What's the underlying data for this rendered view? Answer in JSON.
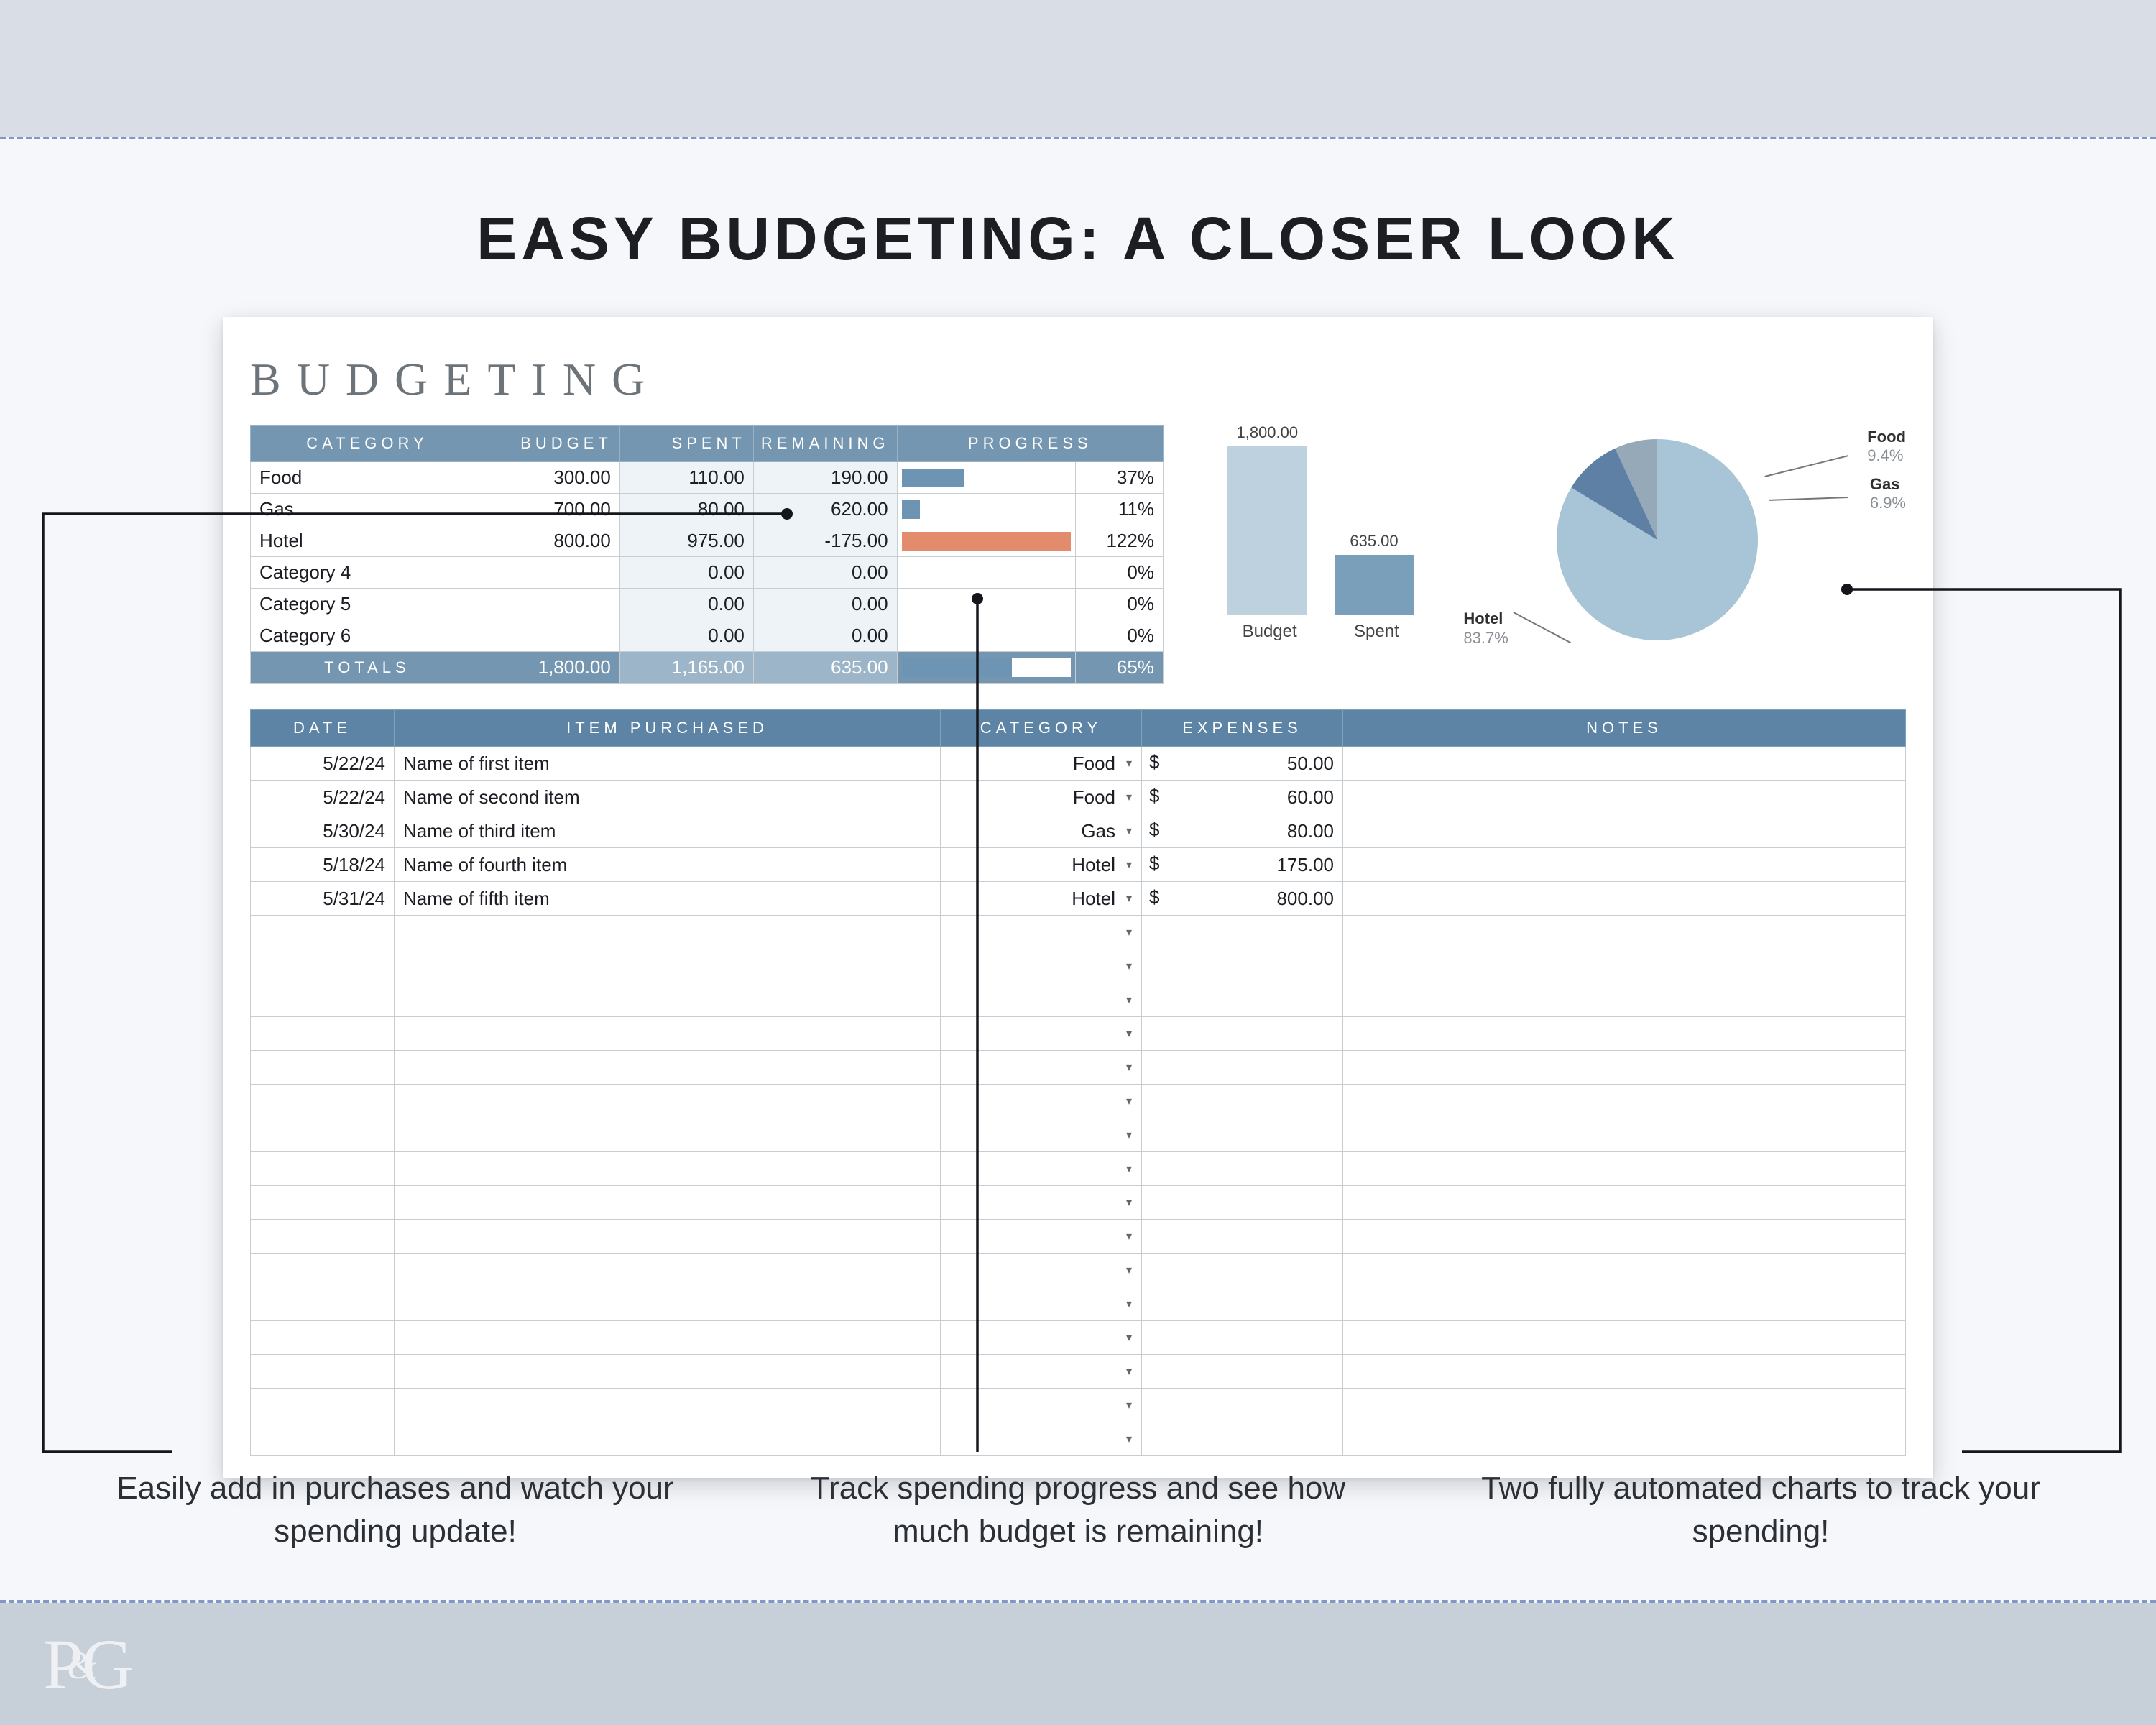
{
  "headline": "EASY BUDGETING: A CLOSER LOOK",
  "spreadsheet_title": "BUDGETING",
  "summary": {
    "headers": {
      "category": "CATEGORY",
      "budget": "BUDGET",
      "spent": "SPENT",
      "remaining": "REMAINING",
      "progress": "PROGRESS"
    },
    "rows": [
      {
        "category": "Food",
        "budget": "300.00",
        "spent": "110.00",
        "remaining": "190.00",
        "progress_pct": 37,
        "pct_text": "37%",
        "over": false
      },
      {
        "category": "Gas",
        "budget": "700.00",
        "spent": "80.00",
        "remaining": "620.00",
        "progress_pct": 11,
        "pct_text": "11%",
        "over": false
      },
      {
        "category": "Hotel",
        "budget": "800.00",
        "spent": "975.00",
        "remaining": "-175.00",
        "progress_pct": 100,
        "pct_text": "122%",
        "over": true
      },
      {
        "category": "Category 4",
        "budget": "",
        "spent": "0.00",
        "remaining": "0.00",
        "progress_pct": 0,
        "pct_text": "0%",
        "over": false
      },
      {
        "category": "Category 5",
        "budget": "",
        "spent": "0.00",
        "remaining": "0.00",
        "progress_pct": 0,
        "pct_text": "0%",
        "over": false
      },
      {
        "category": "Category 6",
        "budget": "",
        "spent": "0.00",
        "remaining": "0.00",
        "progress_pct": 0,
        "pct_text": "0%",
        "over": false
      }
    ],
    "totals": {
      "label": "TOTALS",
      "budget": "1,800.00",
      "spent": "1,165.00",
      "remaining": "635.00",
      "progress_pct": 65,
      "pct_text": "65%"
    }
  },
  "detail": {
    "headers": {
      "date": "DATE",
      "item": "ITEM PURCHASED",
      "category": "CATEGORY",
      "expenses": "EXPENSES",
      "notes": "NOTES"
    },
    "rows": [
      {
        "date": "5/22/24",
        "item": "Name of first item",
        "category": "Food",
        "expense": "50.00",
        "notes": ""
      },
      {
        "date": "5/22/24",
        "item": "Name of second item",
        "category": "Food",
        "expense": "60.00",
        "notes": ""
      },
      {
        "date": "5/30/24",
        "item": "Name of third item",
        "category": "Gas",
        "expense": "80.00",
        "notes": ""
      },
      {
        "date": "5/18/24",
        "item": "Name of fourth item",
        "category": "Hotel",
        "expense": "175.00",
        "notes": ""
      },
      {
        "date": "5/31/24",
        "item": "Name of fifth item",
        "category": "Hotel",
        "expense": "800.00",
        "notes": ""
      }
    ],
    "empty_rows": 16,
    "currency": "$"
  },
  "chart_data": [
    {
      "type": "bar",
      "categories": [
        "Budget",
        "Spent"
      ],
      "values": [
        1800.0,
        635.0
      ],
      "value_labels": [
        "1,800.00",
        "635.00"
      ],
      "title": "",
      "xlabel": "",
      "ylabel": "",
      "ylim": [
        0,
        1800
      ]
    },
    {
      "type": "pie",
      "slices": [
        {
          "name": "Hotel",
          "pct": 83.7,
          "pct_text": "83.7%",
          "color": "#a7c5d6"
        },
        {
          "name": "Food",
          "pct": 9.4,
          "pct_text": "9.4%",
          "color": "#5f80a5"
        },
        {
          "name": "Gas",
          "pct": 6.9,
          "pct_text": "6.9%",
          "color": "#96a9b8"
        }
      ]
    }
  ],
  "callouts": [
    "Easily add in purchases and watch your spending update!",
    "Track spending progress and see how much budget is remaining!",
    "Two fully automated charts to track your spending!"
  ],
  "logo": "P&G"
}
